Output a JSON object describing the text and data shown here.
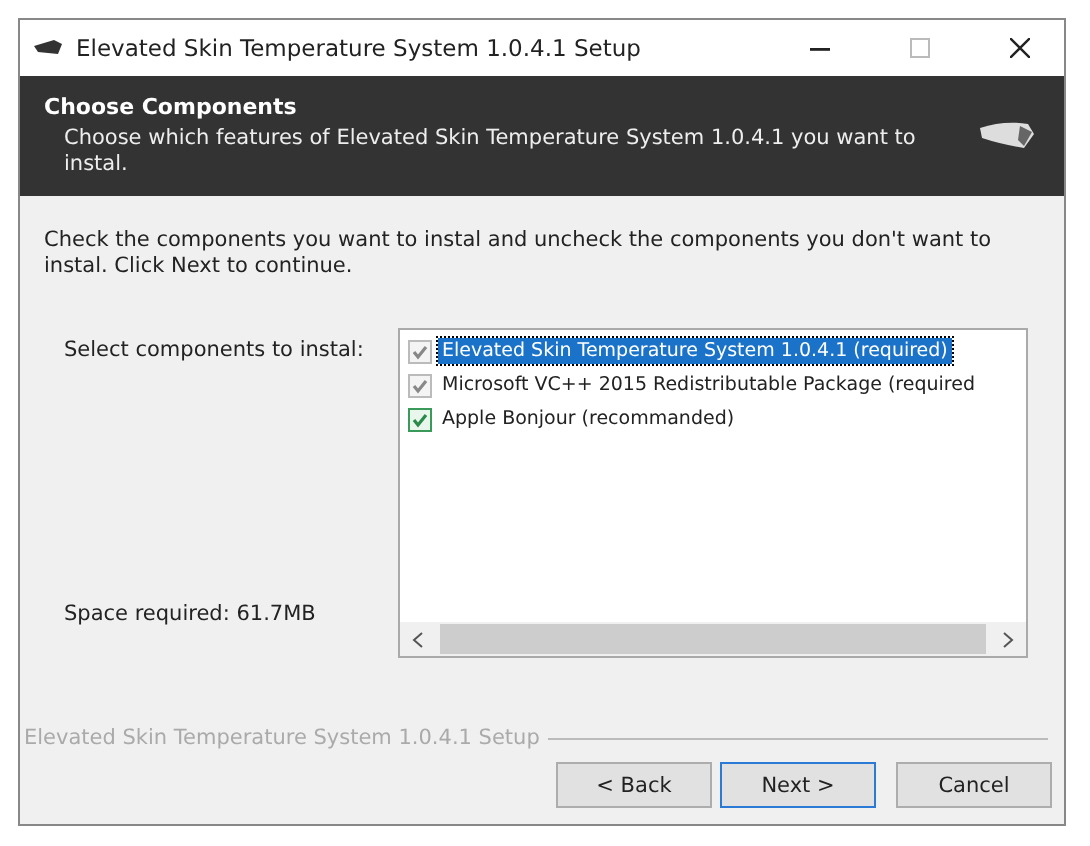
{
  "window": {
    "title": "Elevated Skin Temperature System 1.0.4.1 Setup"
  },
  "header": {
    "title": "Choose Components",
    "subtitle": "Choose which features of Elevated Skin Temperature System 1.0.4.1 you want to instal."
  },
  "description": "Check the components you want to instal and uncheck the components you don't want to instal. Click Next to continue.",
  "select_label": "Select components to instal:",
  "components": [
    {
      "label": "Elevated Skin Temperature System 1.0.4.1 (required)",
      "checked": true,
      "disabled": true,
      "selected": true
    },
    {
      "label": "Microsoft VC++ 2015 Redistributable Package (required",
      "checked": true,
      "disabled": true,
      "selected": false
    },
    {
      "label": "Apple Bonjour (recommanded)",
      "checked": true,
      "disabled": false,
      "selected": false
    }
  ],
  "space_required": "Space required: 61.7MB",
  "branding": "Elevated Skin Temperature System 1.0.4.1 Setup",
  "buttons": [
    {
      "label": "< Back",
      "default": false
    },
    {
      "label": "Next >",
      "default": true
    },
    {
      "label": "Cancel",
      "default": false
    }
  ]
}
